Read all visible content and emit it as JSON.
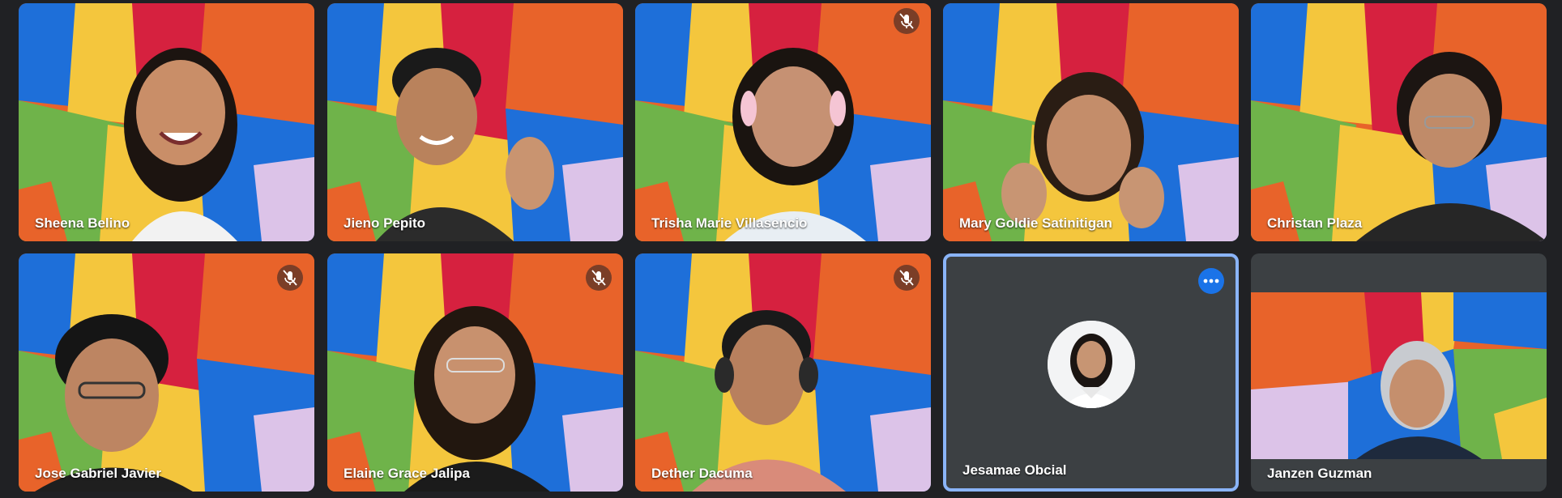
{
  "meeting": {
    "participants": [
      {
        "name": "Sheena Belino",
        "muted": false
      },
      {
        "name": "Jieno Pepito",
        "muted": false
      },
      {
        "name": "Trisha Marie Villasencio",
        "muted": true
      },
      {
        "name": "Mary Goldie Satinitigan",
        "muted": false
      },
      {
        "name": "Christan Plaza",
        "muted": false
      },
      {
        "name": "Jose Gabriel Javier",
        "muted": true
      },
      {
        "name": "Elaine Grace Jalipa",
        "muted": true
      },
      {
        "name": "Dether Dacuma",
        "muted": true
      },
      {
        "name": "Jesamae Obcial",
        "muted": false,
        "camera": "off",
        "pinned_menu": true
      },
      {
        "name": "Janzen Guzman",
        "muted": false
      }
    ]
  },
  "icons": {
    "mute": "mic-off-icon",
    "more": "more-options-icon"
  },
  "colors": {
    "background": "#202124",
    "tile": "#3c4043",
    "accent": "#1a73e8",
    "selected_border": "#8ab4f8"
  }
}
